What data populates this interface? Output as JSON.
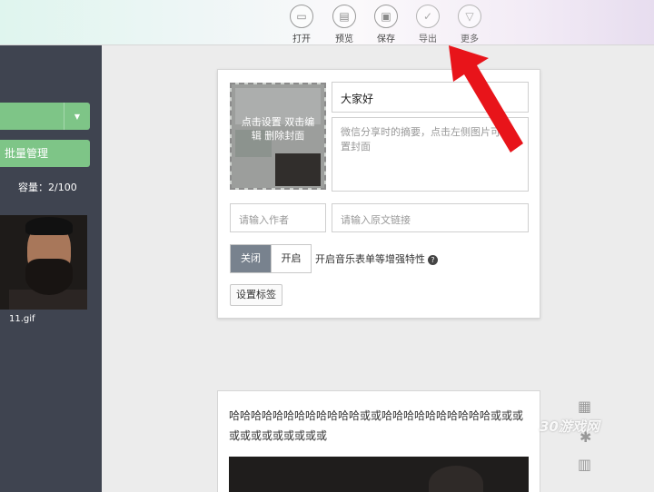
{
  "toolbar": {
    "items": [
      {
        "label": "打开",
        "icon": "folder-icon"
      },
      {
        "label": "预览",
        "icon": "preview-icon"
      },
      {
        "label": "保存",
        "icon": "save-icon"
      },
      {
        "label": "导出",
        "icon": "check-icon"
      },
      {
        "label": "更多",
        "icon": "chevron-down-icon"
      }
    ]
  },
  "sidebar": {
    "batch_label": "批量管理",
    "capacity": "容量：2/100",
    "file_name": "11.gif"
  },
  "editor": {
    "cover_hint": "点击设置 双击编辑 删除封面",
    "title_value": "大家好",
    "summary_placeholder": "微信分享时的摘要，点击左侧图片可设置封面",
    "author_placeholder": "请输入作者",
    "source_placeholder": "请输入原文链接",
    "switch_off": "关闭",
    "switch_on": "开启",
    "switch_desc": "开启音乐表单等增强特性",
    "help_icon": "question-circle-icon",
    "tag_button": "设置标签"
  },
  "preview": {
    "body_text": "哈哈哈哈哈哈哈哈哈哈哈哈或或哈哈哈哈哈哈哈哈哈哈或或或或或或或或或或或或"
  },
  "watermark": "30游戏网",
  "colors": {
    "sidebar_bg": "#3f4450",
    "accent_green": "#7ec587",
    "arrow_red": "#e8141a",
    "switch_off_bg": "#78828e"
  }
}
